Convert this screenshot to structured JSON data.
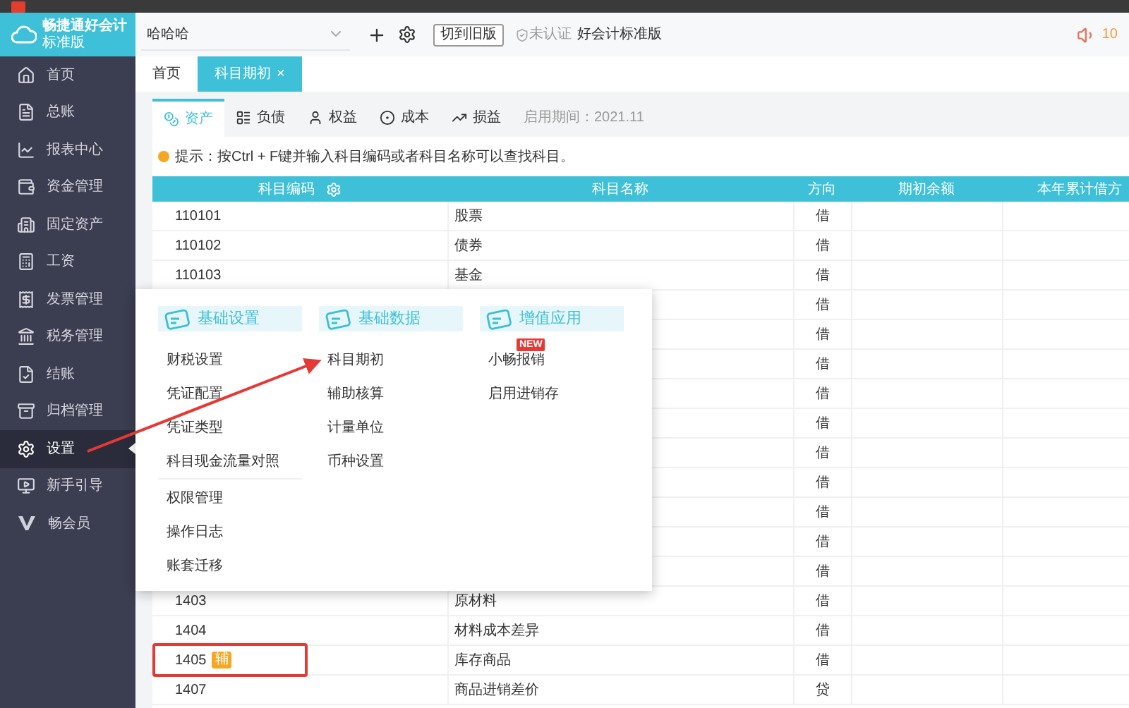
{
  "app": {
    "name": "畅捷通好会计",
    "edition": "标准版"
  },
  "sidebar": {
    "items": [
      {
        "label": "首页",
        "selected": false
      },
      {
        "label": "总账",
        "selected": false
      },
      {
        "label": "报表中心",
        "selected": false
      },
      {
        "label": "资金管理",
        "selected": false
      },
      {
        "label": "固定资产",
        "selected": false
      },
      {
        "label": "工资",
        "selected": false
      },
      {
        "label": "发票管理",
        "selected": false
      },
      {
        "label": "税务管理",
        "selected": false
      },
      {
        "label": "结账",
        "selected": false
      },
      {
        "label": "归档管理",
        "selected": false
      },
      {
        "label": "设置",
        "selected": true
      },
      {
        "label": "新手引导",
        "selected": false
      },
      {
        "label": "畅会员",
        "selected": false
      }
    ]
  },
  "header": {
    "account": "哈哈哈",
    "switch_button": "切到旧版",
    "certification": "未认证",
    "product": "好会计标准版",
    "notice_count": "10"
  },
  "page_tabs": [
    {
      "label": "首页",
      "selected": false
    },
    {
      "label": "科目期初",
      "selected": true,
      "close": "×"
    }
  ],
  "category_tabs": [
    {
      "label": "资产",
      "selected": true
    },
    {
      "label": "负债",
      "selected": false
    },
    {
      "label": "权益",
      "selected": false
    },
    {
      "label": "成本",
      "selected": false
    },
    {
      "label": "损益",
      "selected": false
    }
  ],
  "period": "启用期间：2021.11",
  "hint": "提示：按Ctrl + F键并输入科目编码或者科目名称可以查找科目。",
  "table": {
    "columns": [
      "科目编码",
      "科目名称",
      "方向",
      "期初余额",
      "本年累计借方"
    ],
    "rows": [
      {
        "code": "110101",
        "name": "股票",
        "direction": "借"
      },
      {
        "code": "110102",
        "name": "债券",
        "direction": "借"
      },
      {
        "code": "110103",
        "name": "基金",
        "direction": "借"
      },
      {
        "direction": "借"
      },
      {
        "direction": "借"
      },
      {
        "direction": "借"
      },
      {
        "direction": "借"
      },
      {
        "direction": "借"
      },
      {
        "direction": "借"
      },
      {
        "direction": "借"
      },
      {
        "direction": "借"
      },
      {
        "direction": "借"
      },
      {
        "direction": "借"
      },
      {
        "code": "1403",
        "name": "原材料",
        "direction": "借"
      },
      {
        "code": "1404",
        "name": "材料成本差异",
        "direction": "借"
      },
      {
        "code": "1405",
        "name": "库存商品",
        "direction": "借",
        "badge": "辅",
        "highlighted": true
      },
      {
        "code": "1407",
        "name": "商品进销差价",
        "direction": "贷"
      }
    ]
  },
  "settings_menu": {
    "columns": [
      {
        "title": "基础设置",
        "groups": [
          [
            {
              "label": "财税设置"
            },
            {
              "label": "凭证配置"
            },
            {
              "label": "凭证类型"
            },
            {
              "label": "科目现金流量对照"
            }
          ],
          [
            {
              "label": "权限管理"
            },
            {
              "label": "操作日志"
            },
            {
              "label": "账套迁移"
            }
          ]
        ]
      },
      {
        "title": "基础数据",
        "groups": [
          [
            {
              "label": "科目期初"
            },
            {
              "label": "辅助核算"
            },
            {
              "label": "计量单位"
            },
            {
              "label": "币种设置"
            }
          ]
        ]
      },
      {
        "title": "增值应用",
        "groups": [
          [
            {
              "label": "小畅报销",
              "badge": "NEW"
            },
            {
              "label": "启用进销存"
            }
          ]
        ]
      }
    ]
  }
}
